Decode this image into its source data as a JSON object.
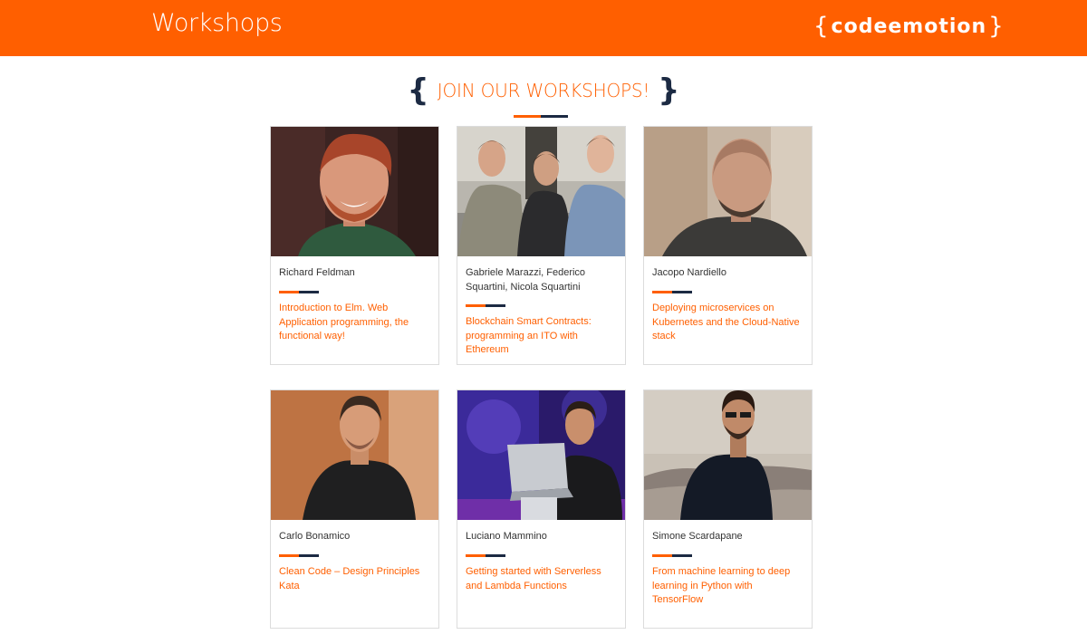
{
  "header": {
    "title": "Workshops",
    "logo": {
      "open": "{",
      "word": "code",
      "mark": "e",
      "word2": "motion",
      "close": "}"
    }
  },
  "section": {
    "open_brace": "{",
    "title": "JOIN OUR WORKSHOPS!",
    "close_brace": "}"
  },
  "colors": {
    "accent": "#ff5f00",
    "navy": "#1c2a43",
    "border": "#dcdcdc"
  },
  "workshops": [
    {
      "speaker": "Richard Feldman",
      "talk": "Introduction to Elm. Web Application programming, the functional way!"
    },
    {
      "speaker": "Gabriele Marazzi, Federico Squartini, Nicola Squartini",
      "talk": "Blockchain Smart Contracts: programming an ITO with Ethereum"
    },
    {
      "speaker": "Jacopo Nardiello",
      "talk": "Deploying microservices on Kubernetes and the Cloud-Native stack"
    },
    {
      "speaker": "Carlo Bonamico",
      "talk": "Clean Code – Design Principles Kata"
    },
    {
      "speaker": "Luciano Mammino",
      "talk": "Getting started with Serverless and Lambda Functions"
    },
    {
      "speaker": "Simone Scardapane",
      "talk": "From machine learning to deep learning in Python with TensorFlow"
    }
  ]
}
